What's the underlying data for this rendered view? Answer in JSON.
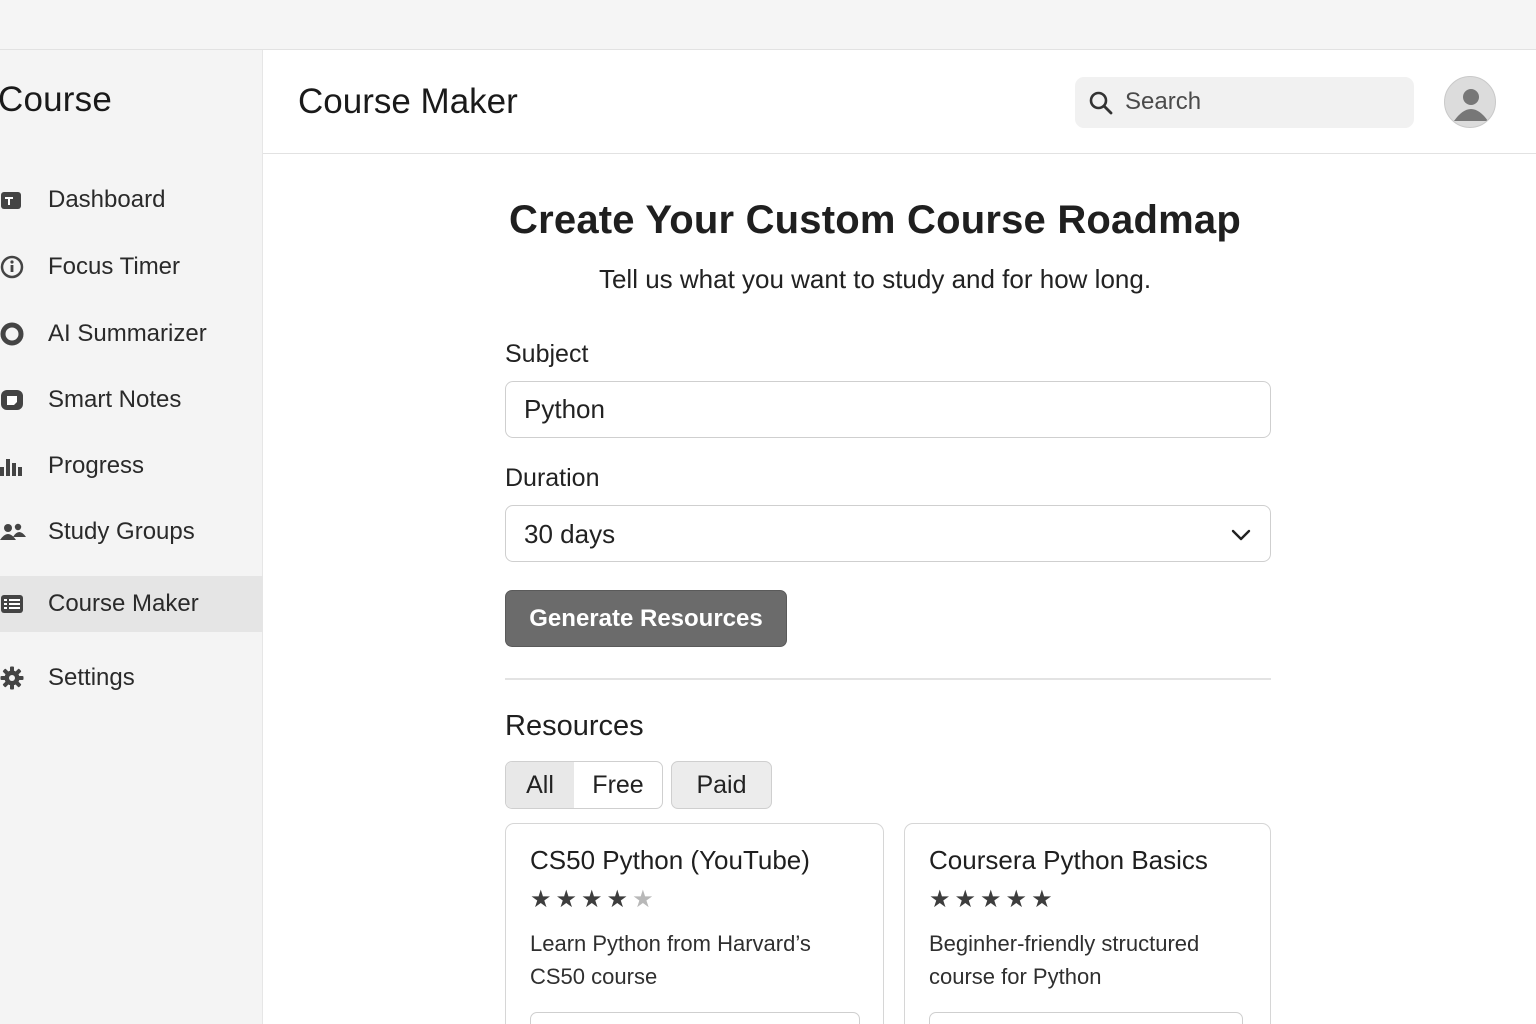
{
  "sidebar": {
    "brand": "Course",
    "items": [
      {
        "label": "Dashboard",
        "icon": "dashboard-icon",
        "active": false
      },
      {
        "label": "Focus Timer",
        "icon": "info-circle-icon",
        "active": false
      },
      {
        "label": "AI Summarizer",
        "icon": "circle-icon",
        "active": false
      },
      {
        "label": "Smart Notes",
        "icon": "note-icon",
        "active": false
      },
      {
        "label": "Progress",
        "icon": "bar-chart-icon",
        "active": false
      },
      {
        "label": "Study Groups",
        "icon": "people-icon",
        "active": false
      },
      {
        "label": "Course Maker",
        "icon": "list-icon",
        "active": true
      },
      {
        "label": "Settings",
        "icon": "gear-icon",
        "active": false
      }
    ]
  },
  "header": {
    "title": "Course Maker",
    "search_placeholder": "Search"
  },
  "main": {
    "heading": "Create Your Custom Course Roadmap",
    "subheading": "Tell us what you want to study and for how long.",
    "subject_label": "Subject",
    "subject_value": "Python",
    "duration_label": "Duration",
    "duration_value": "30 days",
    "generate_label": "Generate Resources",
    "resources_title": "Resources",
    "filters": {
      "all": "All",
      "free": "Free",
      "paid": "Paid",
      "selected": "All"
    },
    "cards": [
      {
        "title": "CS50 Python (YouTube)",
        "rating": 4,
        "rating_max": 5,
        "desc_line1": "Learn Python from Harvard’s",
        "desc_line2": "CS50 course"
      },
      {
        "title": "Coursera Python Basics",
        "rating": 5,
        "rating_max": 5,
        "desc_line1": "Beginher-friendly structured",
        "desc_line2": "course for Python"
      }
    ]
  },
  "colors": {
    "sidebar_bg": "#f4f4f4",
    "active_item_bg": "#e5e5e5",
    "button_bg": "#6b6b6b",
    "star_filled": "#3d3d3d",
    "star_empty": "#b8b8b8"
  }
}
